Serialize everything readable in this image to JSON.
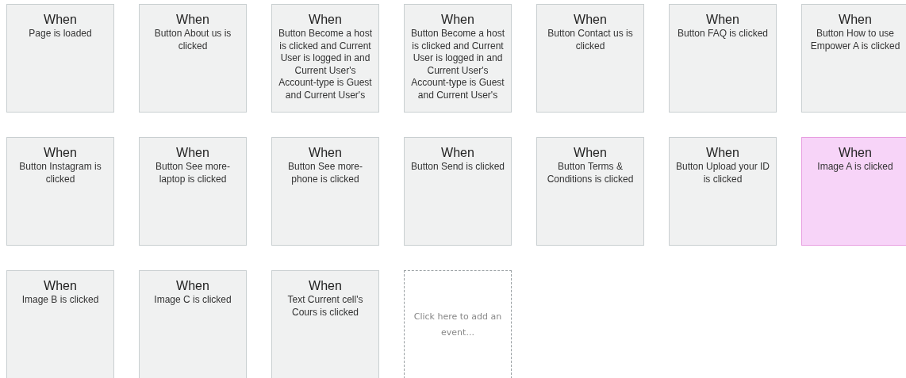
{
  "events": [
    {
      "title": "When",
      "condition": "Page is loaded",
      "selected": false
    },
    {
      "title": "When",
      "condition": "Button About us is clicked",
      "selected": false
    },
    {
      "title": "When",
      "condition": "Button Become a host is clicked and Current User is logged in and Current User's Account-type is Guest and Current User's",
      "selected": false
    },
    {
      "title": "When",
      "condition": "Button Become a host is clicked and Current User is logged in and Current User's Account-type is Guest and Current User's",
      "selected": false
    },
    {
      "title": "When",
      "condition": "Button Contact us is clicked",
      "selected": false
    },
    {
      "title": "When",
      "condition": "Button FAQ is clicked",
      "selected": false
    },
    {
      "title": "When",
      "condition": "Button How to use Empower A is clicked",
      "selected": false
    },
    {
      "title": "When",
      "condition": "Button Instagram is clicked",
      "selected": false
    },
    {
      "title": "When",
      "condition": "Button See more-laptop is clicked",
      "selected": false
    },
    {
      "title": "When",
      "condition": "Button See more-phone is clicked",
      "selected": false
    },
    {
      "title": "When",
      "condition": "Button Send is clicked",
      "selected": false
    },
    {
      "title": "When",
      "condition": "Button Terms & Conditions is clicked",
      "selected": false
    },
    {
      "title": "When",
      "condition": "Button Upload your ID is clicked",
      "selected": false
    },
    {
      "title": "When",
      "condition": "Image A is clicked",
      "selected": true
    },
    {
      "title": "When",
      "condition": "Image B is clicked",
      "selected": false
    },
    {
      "title": "When",
      "condition": "Image C is clicked",
      "selected": false
    },
    {
      "title": "When",
      "condition": "Text Current cell's Cours is clicked",
      "selected": false
    }
  ],
  "add_event": {
    "label": "Click here to add an event..."
  }
}
